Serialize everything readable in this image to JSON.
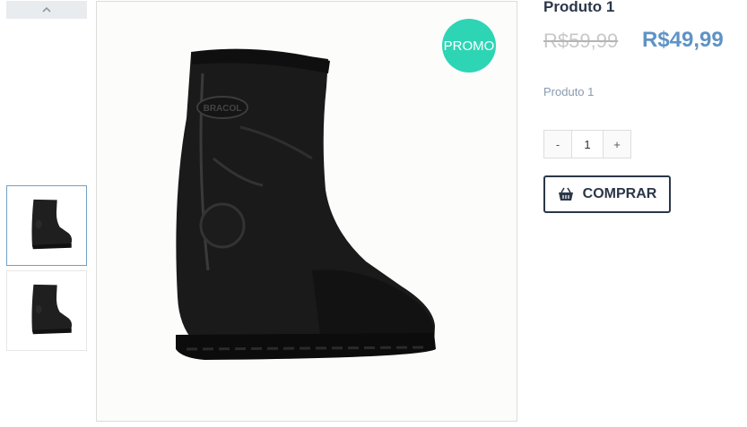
{
  "gallery": {
    "scroll_up_icon": "chevron-up-icon",
    "thumbnails": [
      {
        "alt": "boot-thumbnail-1",
        "active": true
      },
      {
        "alt": "boot-thumbnail-2",
        "active": false
      }
    ],
    "main_image": {
      "brand_mark": "BRACOL"
    },
    "promo_badge": "PROMO"
  },
  "product": {
    "title": "Produto 1",
    "old_price": "R$59,99",
    "price": "R$49,99",
    "description": "Produto 1",
    "quantity": {
      "minus_label": "-",
      "value": "1",
      "plus_label": "+"
    },
    "buy_button": {
      "icon": "basket-icon",
      "label": "COMPRAR"
    }
  },
  "colors": {
    "promo": "#2ed5b5",
    "price": "#5f93c5",
    "old_price": "#c8c8c8",
    "text_dark": "#2b3748",
    "active_thumb_border": "#6e9fc7"
  }
}
